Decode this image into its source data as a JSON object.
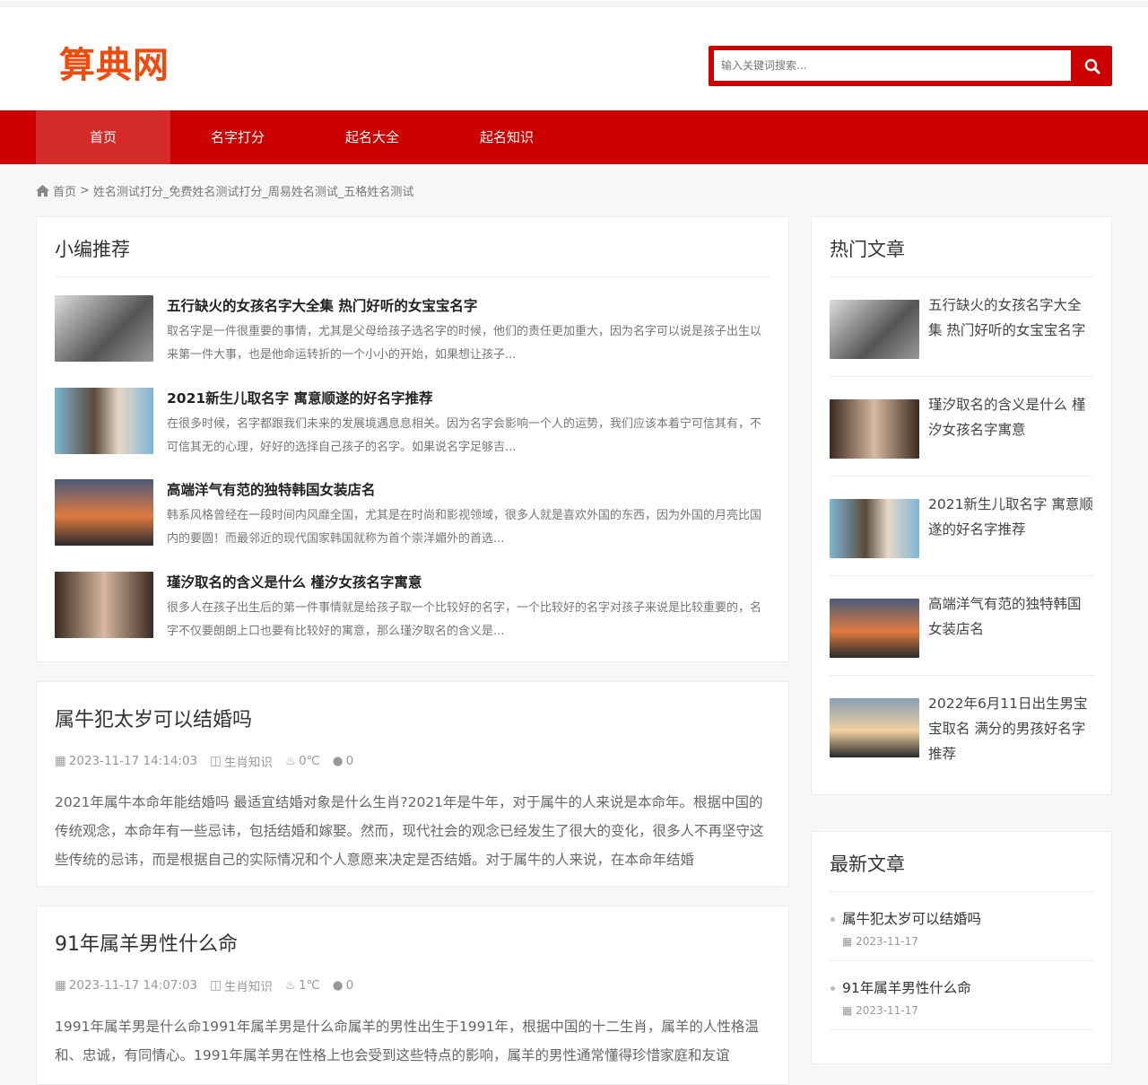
{
  "brand": {
    "logo": "算典网",
    "accent": "#cc0000"
  },
  "search": {
    "placeholder": "输入关键词搜索..."
  },
  "nav": [
    "首页",
    "名字打分",
    "起名大全",
    "起名知识"
  ],
  "breadcrumb": {
    "home": "首页",
    "sep": ">",
    "current": "姓名测试打分_免费姓名测试打分_周易姓名测试_五格姓名测试"
  },
  "recommend": {
    "title": "小编推荐",
    "items": [
      {
        "title": "五行缺火的女孩名字大全集 热门好听的女宝宝名字",
        "summary": "取名字是一件很重要的事情，尤其是父母给孩子选名字的时候，他们的责任更加重大，因为名字可以说是孩子出生以来第一件大事，也是他命运转折的一个小小的开始，如果想让孩子..."
      },
      {
        "title": "2021新生儿取名字 寓意顺遂的好名字推荐",
        "summary": "在很多时候，名字都跟我们未来的发展境遇息息相关。因为名字会影响一个人的运势，我们应该本着宁可信其有，不可信其无的心理，好好的选择自己孩子的名字。如果说名字足够吉..."
      },
      {
        "title": "高端洋气有范的独特韩国女装店名",
        "summary": "韩系风格曾经在一段时间内风靡全国，尤其是在时尚和影视领域，很多人就是喜欢外国的东西，因为外国的月亮比国内的要圆！而最邻近的现代国家韩国就称为首个崇洋媚外的首选..."
      },
      {
        "title": "瑾汐取名的含义是什么 槿汐女孩名字寓意",
        "summary": "很多人在孩子出生后的第一件事情就是给孩子取一个比较好的名字，一个比较好的名字对孩子来说是比较重要的，名字不仅要朗朗上口也要有比较好的寓意，那么瑾汐取名的含义是..."
      }
    ]
  },
  "posts": [
    {
      "title": "属牛犯太岁可以结婚吗",
      "date": "2023-11-17 14:14:03",
      "category": "生肖知识",
      "views": "0℃",
      "comments": "0",
      "excerpt": "2021年属牛本命年能结婚吗 最适宜结婚对象是什么生肖?2021年是牛年，对于属牛的人来说是本命年。根据中国的传统观念，本命年有一些忌讳，包括结婚和嫁娶。然而，现代社会的观念已经发生了很大的变化，很多人不再坚守这些传统的忌讳，而是根据自己的实际情况和个人意愿来决定是否结婚。对于属牛的人来说，在本命年结婚"
    },
    {
      "title": "91年属羊男性什么命",
      "date": "2023-11-17 14:07:03",
      "category": "生肖知识",
      "views": "1℃",
      "comments": "0",
      "excerpt": "1991年属羊男是什么命1991年属羊男是什么命属羊的男性出生于1991年，根据中国的十二生肖，属羊的人性格温和、忠诚，有同情心。1991年属羊男在性格上也会受到这些特点的影响，属羊的男性通常懂得珍惜家庭和友谊"
    }
  ],
  "hot": {
    "title": "热门文章",
    "items": [
      "五行缺火的女孩名字大全集 热门好听的女宝宝名字",
      "瑾汐取名的含义是什么 槿汐女孩名字寓意",
      "2021新生儿取名字 寓意顺遂的好名字推荐",
      "高端洋气有范的独特韩国女装店名",
      "2022年6月11日出生男宝宝取名 满分的男孩好名字推荐"
    ]
  },
  "latest": {
    "title": "最新文章",
    "items": [
      {
        "title": "属牛犯太岁可以结婚吗",
        "date": "2023-11-17"
      },
      {
        "title": "91年属羊男性什么命",
        "date": "2023-11-17"
      }
    ]
  }
}
